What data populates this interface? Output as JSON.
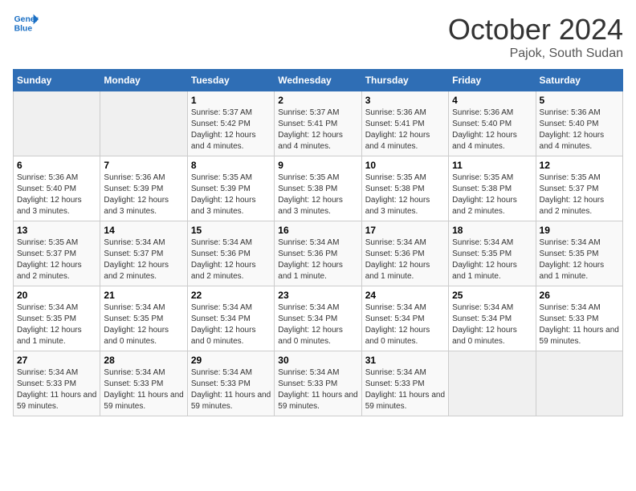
{
  "logo": {
    "line1": "General",
    "line2": "Blue"
  },
  "title": "October 2024",
  "location": "Pajok, South Sudan",
  "weekdays": [
    "Sunday",
    "Monday",
    "Tuesday",
    "Wednesday",
    "Thursday",
    "Friday",
    "Saturday"
  ],
  "weeks": [
    [
      {
        "day": "",
        "info": ""
      },
      {
        "day": "",
        "info": ""
      },
      {
        "day": "1",
        "info": "Sunrise: 5:37 AM\nSunset: 5:42 PM\nDaylight: 12 hours and 4 minutes."
      },
      {
        "day": "2",
        "info": "Sunrise: 5:37 AM\nSunset: 5:41 PM\nDaylight: 12 hours and 4 minutes."
      },
      {
        "day": "3",
        "info": "Sunrise: 5:36 AM\nSunset: 5:41 PM\nDaylight: 12 hours and 4 minutes."
      },
      {
        "day": "4",
        "info": "Sunrise: 5:36 AM\nSunset: 5:40 PM\nDaylight: 12 hours and 4 minutes."
      },
      {
        "day": "5",
        "info": "Sunrise: 5:36 AM\nSunset: 5:40 PM\nDaylight: 12 hours and 4 minutes."
      }
    ],
    [
      {
        "day": "6",
        "info": "Sunrise: 5:36 AM\nSunset: 5:40 PM\nDaylight: 12 hours and 3 minutes."
      },
      {
        "day": "7",
        "info": "Sunrise: 5:36 AM\nSunset: 5:39 PM\nDaylight: 12 hours and 3 minutes."
      },
      {
        "day": "8",
        "info": "Sunrise: 5:35 AM\nSunset: 5:39 PM\nDaylight: 12 hours and 3 minutes."
      },
      {
        "day": "9",
        "info": "Sunrise: 5:35 AM\nSunset: 5:38 PM\nDaylight: 12 hours and 3 minutes."
      },
      {
        "day": "10",
        "info": "Sunrise: 5:35 AM\nSunset: 5:38 PM\nDaylight: 12 hours and 3 minutes."
      },
      {
        "day": "11",
        "info": "Sunrise: 5:35 AM\nSunset: 5:38 PM\nDaylight: 12 hours and 2 minutes."
      },
      {
        "day": "12",
        "info": "Sunrise: 5:35 AM\nSunset: 5:37 PM\nDaylight: 12 hours and 2 minutes."
      }
    ],
    [
      {
        "day": "13",
        "info": "Sunrise: 5:35 AM\nSunset: 5:37 PM\nDaylight: 12 hours and 2 minutes."
      },
      {
        "day": "14",
        "info": "Sunrise: 5:34 AM\nSunset: 5:37 PM\nDaylight: 12 hours and 2 minutes."
      },
      {
        "day": "15",
        "info": "Sunrise: 5:34 AM\nSunset: 5:36 PM\nDaylight: 12 hours and 2 minutes."
      },
      {
        "day": "16",
        "info": "Sunrise: 5:34 AM\nSunset: 5:36 PM\nDaylight: 12 hours and 1 minute."
      },
      {
        "day": "17",
        "info": "Sunrise: 5:34 AM\nSunset: 5:36 PM\nDaylight: 12 hours and 1 minute."
      },
      {
        "day": "18",
        "info": "Sunrise: 5:34 AM\nSunset: 5:35 PM\nDaylight: 12 hours and 1 minute."
      },
      {
        "day": "19",
        "info": "Sunrise: 5:34 AM\nSunset: 5:35 PM\nDaylight: 12 hours and 1 minute."
      }
    ],
    [
      {
        "day": "20",
        "info": "Sunrise: 5:34 AM\nSunset: 5:35 PM\nDaylight: 12 hours and 1 minute."
      },
      {
        "day": "21",
        "info": "Sunrise: 5:34 AM\nSunset: 5:35 PM\nDaylight: 12 hours and 0 minutes."
      },
      {
        "day": "22",
        "info": "Sunrise: 5:34 AM\nSunset: 5:34 PM\nDaylight: 12 hours and 0 minutes."
      },
      {
        "day": "23",
        "info": "Sunrise: 5:34 AM\nSunset: 5:34 PM\nDaylight: 12 hours and 0 minutes."
      },
      {
        "day": "24",
        "info": "Sunrise: 5:34 AM\nSunset: 5:34 PM\nDaylight: 12 hours and 0 minutes."
      },
      {
        "day": "25",
        "info": "Sunrise: 5:34 AM\nSunset: 5:34 PM\nDaylight: 12 hours and 0 minutes."
      },
      {
        "day": "26",
        "info": "Sunrise: 5:34 AM\nSunset: 5:33 PM\nDaylight: 11 hours and 59 minutes."
      }
    ],
    [
      {
        "day": "27",
        "info": "Sunrise: 5:34 AM\nSunset: 5:33 PM\nDaylight: 11 hours and 59 minutes."
      },
      {
        "day": "28",
        "info": "Sunrise: 5:34 AM\nSunset: 5:33 PM\nDaylight: 11 hours and 59 minutes."
      },
      {
        "day": "29",
        "info": "Sunrise: 5:34 AM\nSunset: 5:33 PM\nDaylight: 11 hours and 59 minutes."
      },
      {
        "day": "30",
        "info": "Sunrise: 5:34 AM\nSunset: 5:33 PM\nDaylight: 11 hours and 59 minutes."
      },
      {
        "day": "31",
        "info": "Sunrise: 5:34 AM\nSunset: 5:33 PM\nDaylight: 11 hours and 59 minutes."
      },
      {
        "day": "",
        "info": ""
      },
      {
        "day": "",
        "info": ""
      }
    ]
  ]
}
